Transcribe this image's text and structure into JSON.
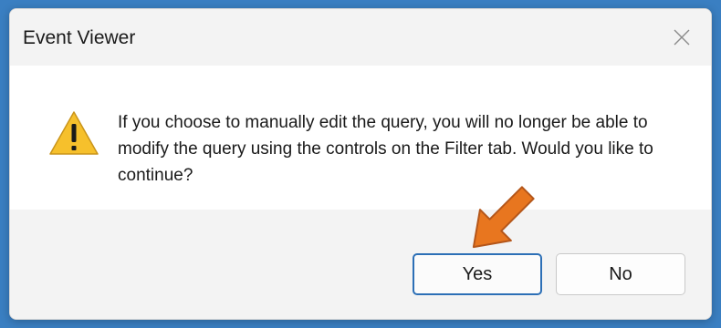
{
  "dialog": {
    "title": "Event Viewer",
    "message": "If you choose to manually edit the query, you will no longer be able to modify the query using the controls on the Filter tab. Would you like to continue?",
    "icon": "warning-icon",
    "close_icon": "close-icon"
  },
  "buttons": {
    "yes_label": "Yes",
    "no_label": "No"
  },
  "annotation": {
    "arrow_icon": "arrow-pointer-icon",
    "arrow_color": "#e8761f"
  },
  "colors": {
    "background": "#3a7fc2",
    "titlebar": "#f3f3f3",
    "footer": "#f3f3f3",
    "focus_border": "#2c6fb6",
    "warning_fill": "#f6c02c"
  }
}
